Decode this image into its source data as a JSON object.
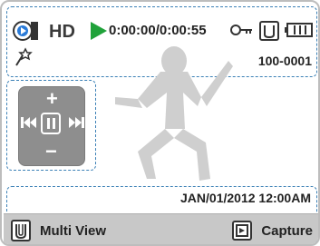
{
  "status_bar": {
    "quality": "HD",
    "timecode": "0:00:00/0:00:55",
    "play_color": "#20a23a"
  },
  "info": {
    "file_number": "100-0001",
    "datetime": "JAN/01/2012 12:00AM"
  },
  "icons": {
    "mode": "movie-playback-icon",
    "scene": "scene-effect-icon",
    "lock": "key-lock-icon",
    "multiview_small": "multiview-indicator-icon",
    "battery": "battery-icon",
    "rewind": "rewind-icon",
    "pause": "pause-icon",
    "fast_forward": "fast-forward-icon"
  },
  "controls": {
    "volume_up": "+",
    "volume_down": "−"
  },
  "buttons": {
    "multi_view": "Multi View",
    "capture": "Capture"
  }
}
